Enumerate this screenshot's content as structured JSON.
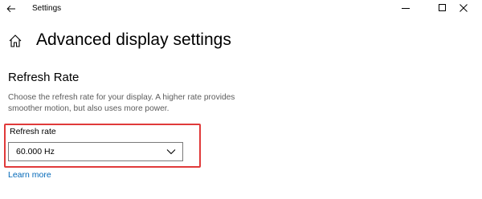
{
  "window": {
    "title": "Settings"
  },
  "page": {
    "title": "Advanced display settings"
  },
  "refresh_section": {
    "heading": "Refresh Rate",
    "description": "Choose the refresh rate for your display. A higher rate provides smoother motion, but also uses more power.",
    "field_label": "Refresh rate",
    "selected_value": "60.000 Hz",
    "learn_more": "Learn more"
  },
  "colors": {
    "accent_link": "#0067b8",
    "highlight_box": "#e03a3a"
  },
  "icons": {
    "back": "back-arrow-icon",
    "home": "home-icon",
    "minimize": "minimize-icon",
    "maximize": "maximize-icon",
    "close": "close-icon",
    "dropdown": "chevron-down-icon"
  }
}
